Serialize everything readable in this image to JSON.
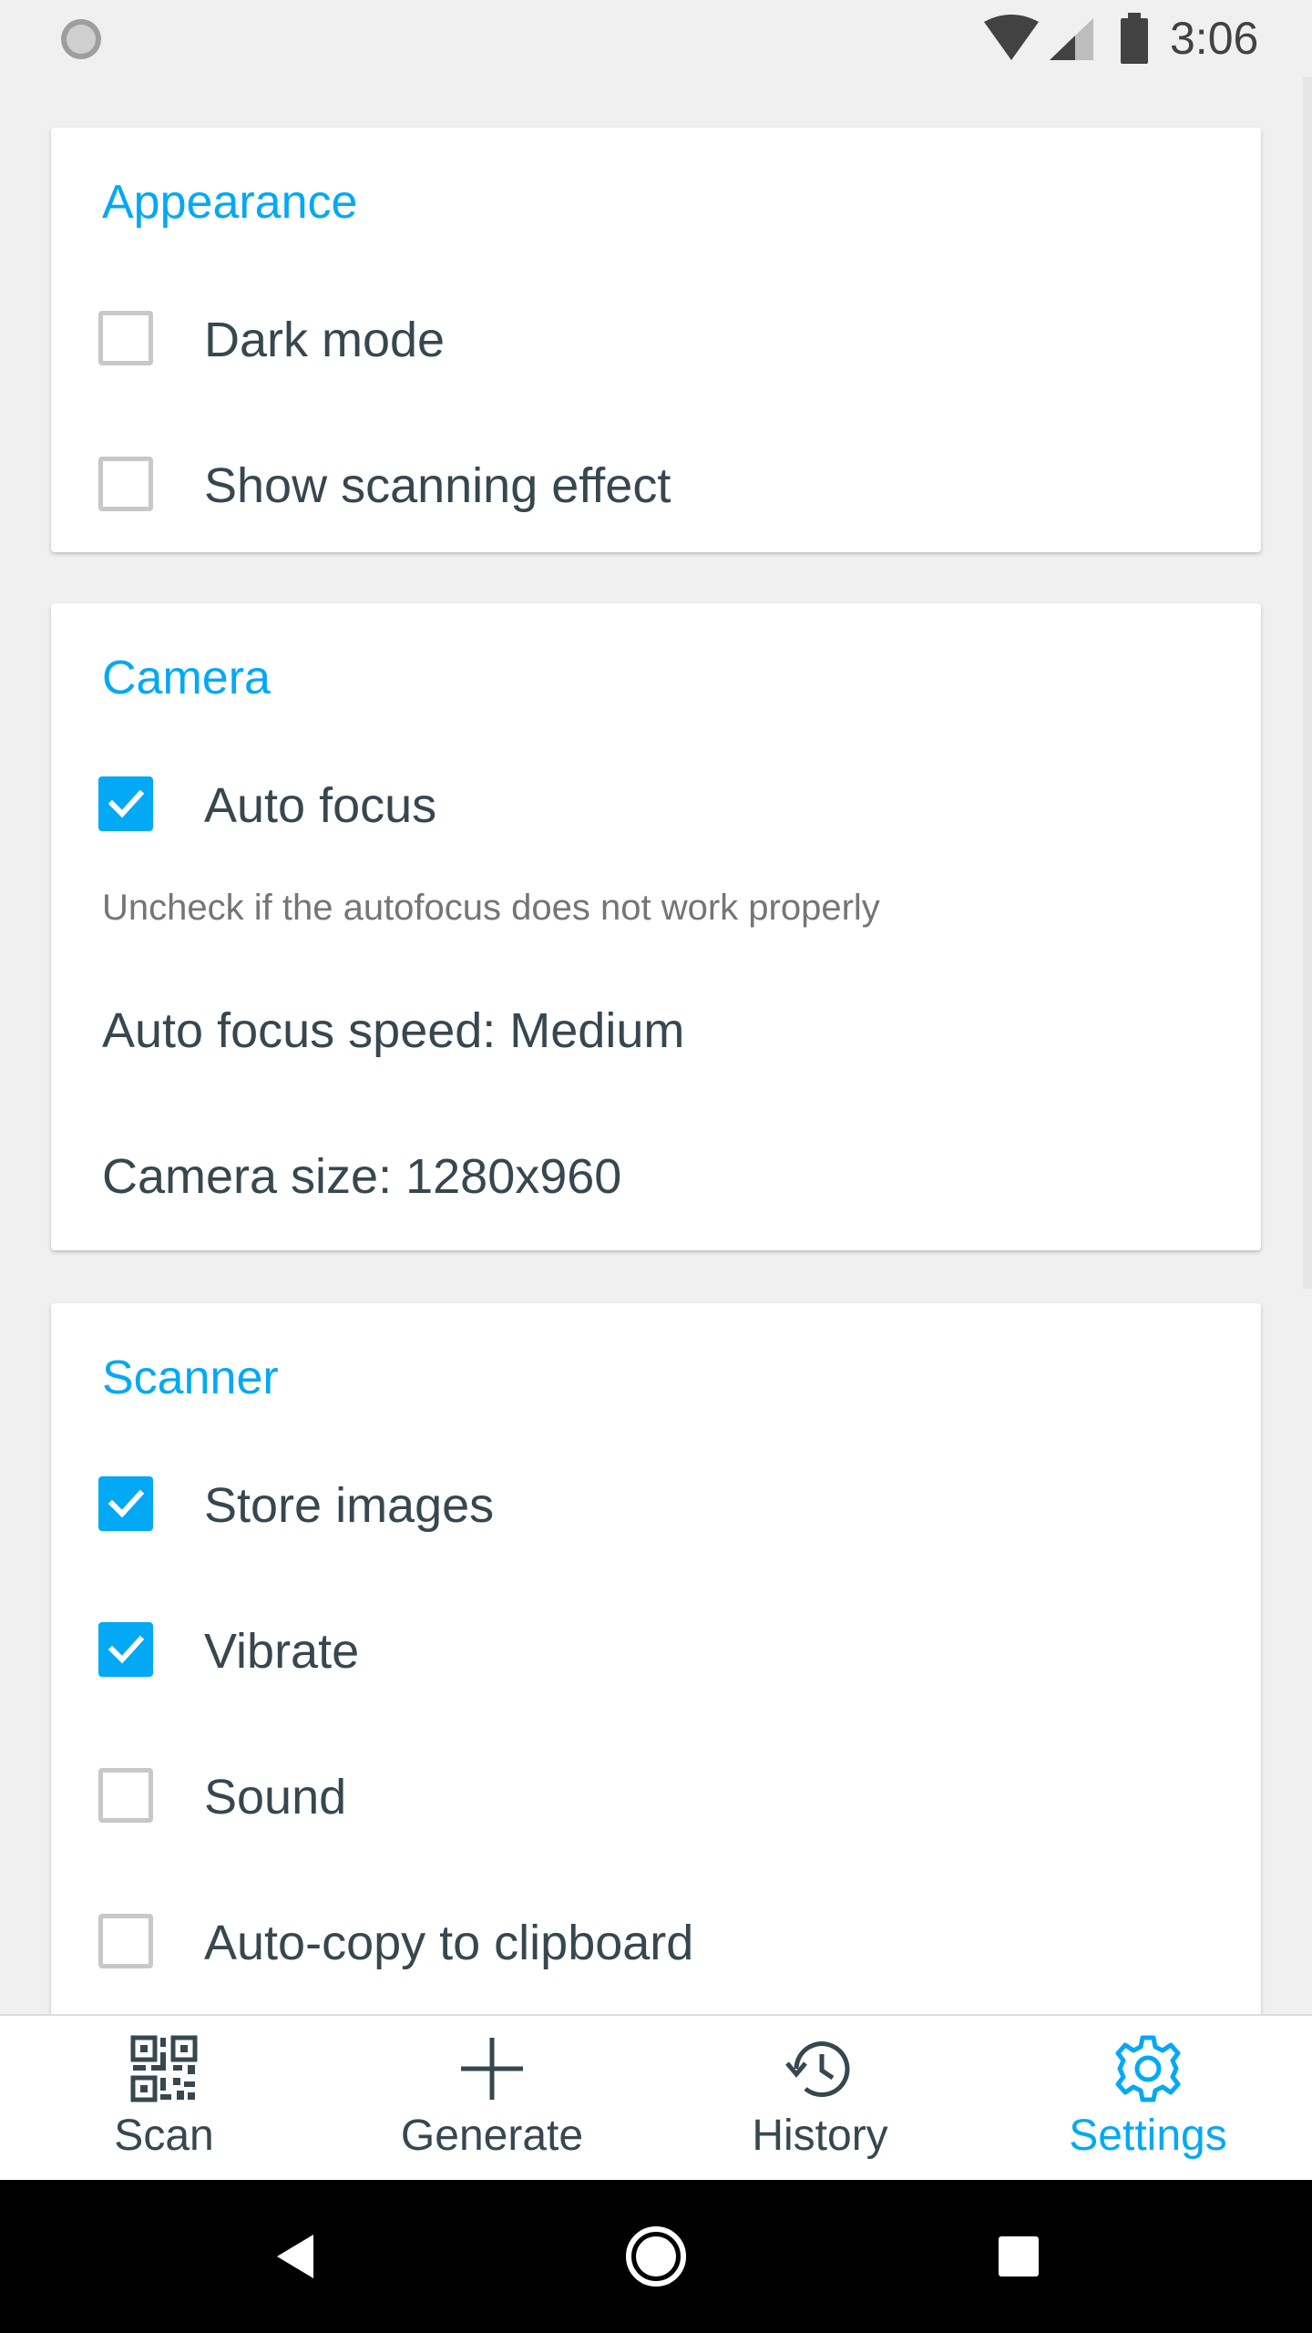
{
  "status_bar": {
    "time": "3:06"
  },
  "colors": {
    "accent": "#03a9f4",
    "text": "#37474f",
    "hint": "#757575",
    "checkbox_border": "#c8c8c8"
  },
  "sections": {
    "appearance": {
      "title": "Appearance",
      "dark_mode": {
        "label": "Dark mode",
        "checked": false
      },
      "scanning_effect": {
        "label": "Show scanning effect",
        "checked": false
      }
    },
    "camera": {
      "title": "Camera",
      "auto_focus": {
        "label": "Auto focus",
        "checked": true
      },
      "auto_focus_hint": "Uncheck if the autofocus does not work properly",
      "auto_focus_speed": "Auto focus speed: Medium",
      "camera_size": "Camera size: 1280x960"
    },
    "scanner": {
      "title": "Scanner",
      "store_images": {
        "label": "Store images",
        "checked": true
      },
      "vibrate": {
        "label": "Vibrate",
        "checked": true
      },
      "sound": {
        "label": "Sound",
        "checked": false
      },
      "auto_copy": {
        "label": "Auto-copy to clipboard",
        "checked": false
      }
    }
  },
  "bottom_nav": {
    "scan": {
      "label": "Scan",
      "icon": "qr-code-icon"
    },
    "generate": {
      "label": "Generate",
      "icon": "plus-icon"
    },
    "history": {
      "label": "History",
      "icon": "history-icon"
    },
    "settings": {
      "label": "Settings",
      "icon": "gear-icon",
      "active": true
    }
  },
  "system_nav": {
    "back": "back-icon",
    "home": "home-icon",
    "recents": "recents-icon"
  }
}
